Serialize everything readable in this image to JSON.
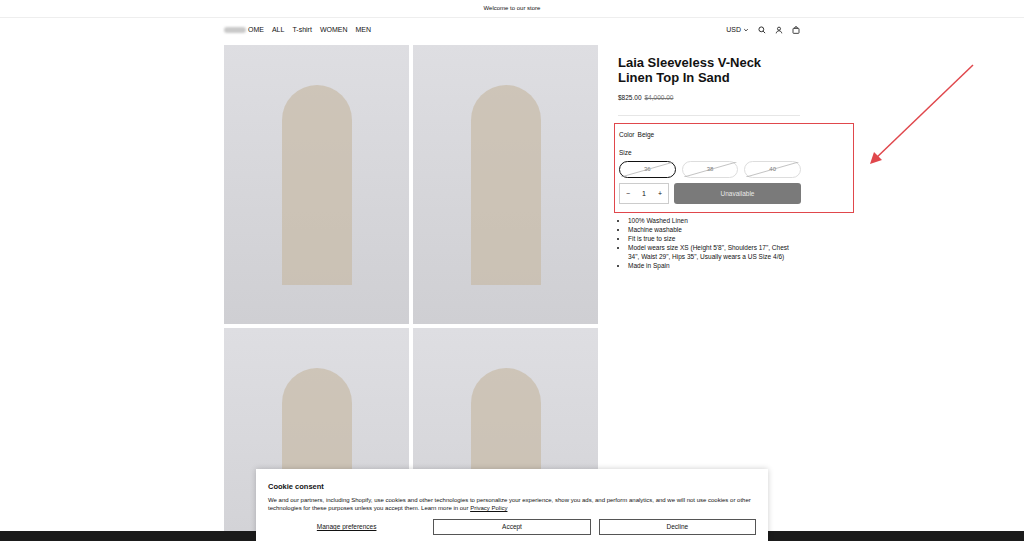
{
  "announcement": "Welcome to our store",
  "header": {
    "nav": [
      {
        "label": "OME"
      },
      {
        "label": "ALL"
      },
      {
        "label": "T-shirt"
      },
      {
        "label": "WOMEN"
      },
      {
        "label": "MEN"
      }
    ],
    "currency": "USD"
  },
  "product": {
    "title": "Laia Sleeveless V-Neck Linen Top In Sand",
    "price": "$825.00",
    "compare_price": "$4,000.00",
    "color_label": "Color",
    "color_value": "Beige",
    "size_label": "Size",
    "sizes": [
      {
        "label": "36",
        "selected": true,
        "available": false
      },
      {
        "label": "38",
        "selected": false,
        "available": false
      },
      {
        "label": "40",
        "selected": false,
        "available": false
      }
    ],
    "quantity": {
      "minus": "−",
      "value": "1",
      "plus": "+"
    },
    "add_button": {
      "label": "Unavailable",
      "disabled": true
    },
    "bullets": [
      "100% Washed Linen",
      "Machine washable",
      "Fit is true to size",
      "Model wears size XS (Height 5'8\", Shoulders 17\", Chest 34\", Waist 29\", Hips 35\", Usually wears a US Size 4/6)",
      "Made in Spain"
    ]
  },
  "cookie": {
    "title": "Cookie consent",
    "text": "We and our partners, including Shopify, use cookies and other technologies to personalize your experience, show you ads, and perform analytics, and we will not use cookies or other technologies for these purposes unless you accept them. Learn more in our ",
    "link": "Privacy Policy",
    "buttons": [
      {
        "label": "Manage preferences",
        "kind": "link"
      },
      {
        "label": "Accept",
        "kind": "outline"
      },
      {
        "label": "Decline",
        "kind": "outline"
      }
    ]
  }
}
